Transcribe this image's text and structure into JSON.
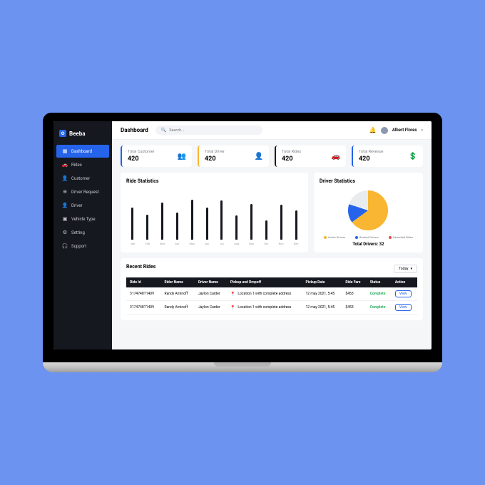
{
  "brand": "Beeba",
  "sidebar": {
    "items": [
      {
        "label": "Dashboard",
        "icon": "▦"
      },
      {
        "label": "Rides",
        "icon": "🚗"
      },
      {
        "label": "Customer",
        "icon": "👤"
      },
      {
        "label": "Driver Request",
        "icon": "⊕"
      },
      {
        "label": "Driver",
        "icon": "👤"
      },
      {
        "label": "Vehicle Type",
        "icon": "▣"
      },
      {
        "label": "Setting",
        "icon": "⚙"
      },
      {
        "label": "Support",
        "icon": "🎧"
      }
    ],
    "active_index": 0
  },
  "header": {
    "title": "Dashboard",
    "search_placeholder": "Search...",
    "user_name": "Albert Flores"
  },
  "stats": [
    {
      "label": "Total Customer",
      "value": "420",
      "icon": "👥"
    },
    {
      "label": "Total Driver",
      "value": "420",
      "icon": "👤"
    },
    {
      "label": "Total Rides",
      "value": "420",
      "icon": "🚗"
    },
    {
      "label": "Total Revenue",
      "value": "420",
      "icon": "💲"
    }
  ],
  "ride_stats_title": "Ride Statistics",
  "driver_stats_title": "Driver Statistics",
  "legend": [
    {
      "color": "#f8b632",
      "label": "Active Drivers"
    },
    {
      "color": "#2563eb",
      "label": "Booked Drivers"
    },
    {
      "color": "#e94c4c",
      "label": "Cancelled Rides"
    }
  ],
  "total_drivers_label": "Total Drivers: 32",
  "chart_data": {
    "bar": {
      "type": "bar",
      "categories": [
        "Jan",
        "Feb",
        "Mar",
        "Apr",
        "May",
        "Jun",
        "Jul",
        "Aug",
        "Sep",
        "Oct",
        "Nov",
        "Dec"
      ],
      "values": [
        65,
        50,
        75,
        55,
        80,
        65,
        78,
        48,
        72,
        38,
        70,
        58
      ],
      "ylim": [
        0,
        100
      ]
    },
    "pie": {
      "type": "pie",
      "series": [
        {
          "name": "Active Drivers",
          "value": 65,
          "color": "#f8b632"
        },
        {
          "name": "Booked Drivers",
          "value": 15,
          "color": "#2563eb"
        },
        {
          "name": "Cancelled Rides",
          "value": 20,
          "color": "#e9ecef"
        }
      ]
    }
  },
  "recent": {
    "title": "Recent Rides",
    "filter": "Today",
    "columns": [
      "Ride Id",
      "Rider Name",
      "Driver Name",
      "Pickup and Dropoff",
      "Pickup Date",
      "Ride Fare",
      "Status",
      "Action"
    ],
    "rows": [
      {
        "id": "3174748T1409",
        "rider": "Randy Aminoff",
        "driver": "Jaylon Carder",
        "loc": "Location 1 with complete address",
        "date": "12 may 2021, 5:45",
        "fare": "$453",
        "status": "Complete",
        "action": "View"
      },
      {
        "id": "3174748T1409",
        "rider": "Randy Aminoff",
        "driver": "Jaylon Carder",
        "loc": "Location 1 with complete address",
        "date": "12 may 2021, 5:45",
        "fare": "$453",
        "status": "Complete",
        "action": "View"
      }
    ]
  }
}
